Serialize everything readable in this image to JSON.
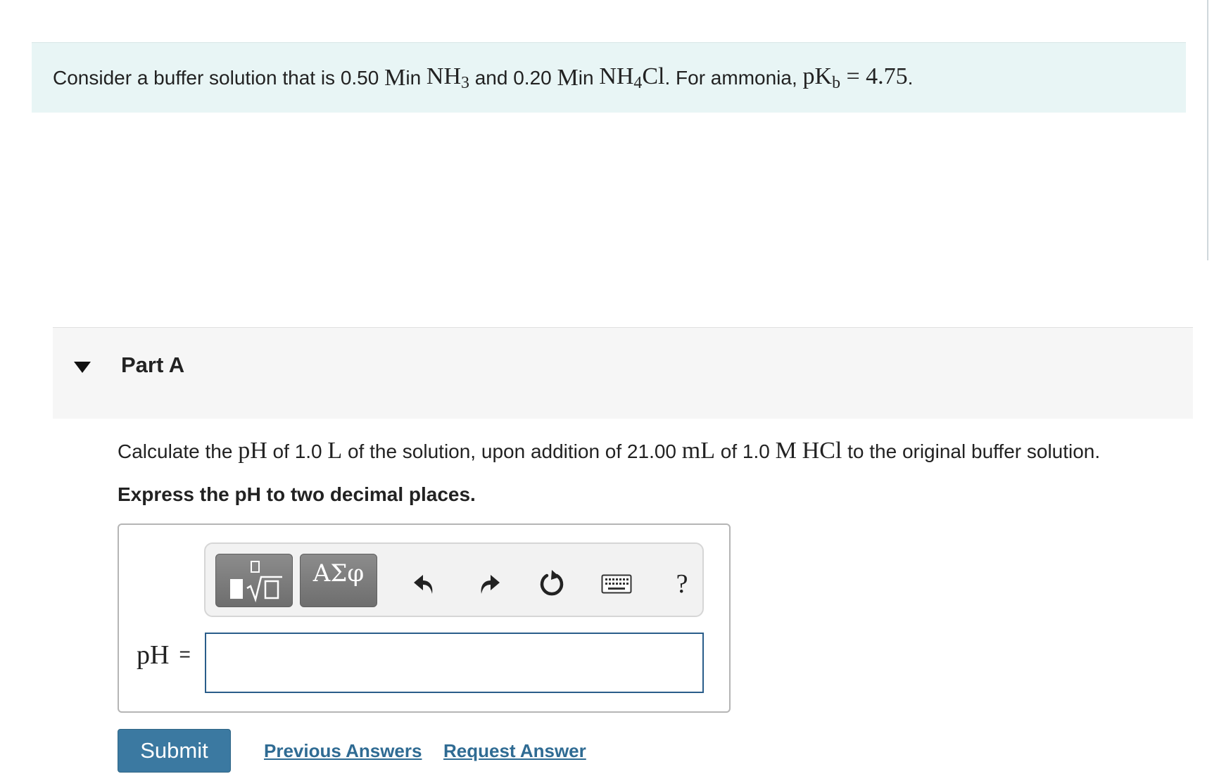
{
  "intro": {
    "t1": "Consider a buffer solution that is 0.50 ",
    "unit_m1": "M",
    "t2": " in ",
    "nh3_base": "NH",
    "nh3_sub": "3",
    "t3": " and 0.20 ",
    "unit_m2": "M",
    "t4": " in ",
    "nh4_base": "NH",
    "nh4_sub": "4",
    "nh4_tail": "Cl",
    "t5": ". For ammonia, ",
    "pkb_base": "pK",
    "pkb_sub": "b",
    "pkb_eq": " = 4.75",
    "t6": "."
  },
  "part": {
    "collapse_icon": "caret-down-icon",
    "title": "Part A"
  },
  "question": {
    "t1": "Calculate the ",
    "ph": "pH",
    "t2": " of 1.0 ",
    "unit_l": "L",
    "t3": " of the solution, upon addition of 21.00 ",
    "unit_ml": "mL",
    "t4": " of 1.0 ",
    "unit_m": "M",
    "t5": " ",
    "hcl": "HCl",
    "t6": " to the original buffer solution.",
    "instruction": "Express the pH to two decimal places."
  },
  "toolbar": {
    "templates_icon": "templates-radical-icon",
    "symbols_label": "ΑΣφ",
    "undo_icon": "undo-icon",
    "redo_icon": "redo-icon",
    "reset_icon": "reset-icon",
    "keyboard_icon": "keyboard-icon",
    "help_label": "?"
  },
  "answer": {
    "label": "pH",
    "equals": "=",
    "value": ""
  },
  "actions": {
    "submit": "Submit",
    "previous_answers": "Previous Answers",
    "request_answer": "Request Answer"
  },
  "colors": {
    "intro_bg": "#e8f5f5",
    "part_bg": "#f6f6f6",
    "submit_bg": "#3b79a1",
    "link": "#2f6b93",
    "input_border": "#2a5d8a"
  }
}
